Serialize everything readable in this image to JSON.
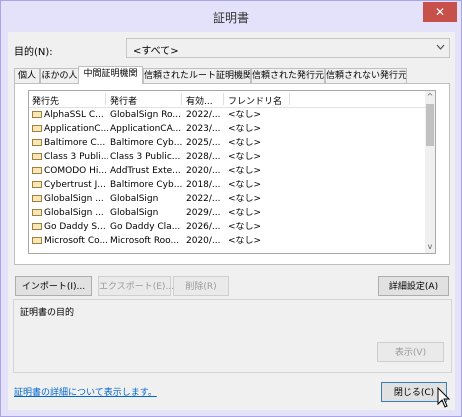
{
  "window": {
    "title": "証明書",
    "close_glyph": "✕"
  },
  "purpose": {
    "label": "目的(N):",
    "value": "<すべて>"
  },
  "tabs": [
    {
      "label": "個人"
    },
    {
      "label": "ほかの人"
    },
    {
      "label": "中間証明機関"
    },
    {
      "label": "信頼されたルート証明機関"
    },
    {
      "label": "信頼された発行元"
    },
    {
      "label": "信頼されない発行元"
    }
  ],
  "columns": [
    "発行先",
    "発行者",
    "有効...",
    "フレンドリ名"
  ],
  "rows": [
    {
      "issued_to": "AlphaSSL C...",
      "issued_by": "GlobalSign Ro...",
      "expires": "2022/...",
      "friendly": "<なし>"
    },
    {
      "issued_to": "ApplicationC...",
      "issued_by": "ApplicationCA...",
      "expires": "2023/...",
      "friendly": "<なし>"
    },
    {
      "issued_to": "Baltimore C...",
      "issued_by": "Baltimore Cyb...",
      "expires": "2025/...",
      "friendly": "<なし>"
    },
    {
      "issued_to": "Class 3 Publi...",
      "issued_by": "Class 3 Public...",
      "expires": "2028/...",
      "friendly": "<なし>"
    },
    {
      "issued_to": "COMODO Hi...",
      "issued_by": "AddTrust Exte...",
      "expires": "2020/...",
      "friendly": "<なし>"
    },
    {
      "issued_to": "Cybertrust J...",
      "issued_by": "Baltimore Cyb...",
      "expires": "2018/...",
      "friendly": "<なし>"
    },
    {
      "issued_to": "GlobalSign ...",
      "issued_by": "GlobalSign",
      "expires": "2022/...",
      "friendly": "<なし>"
    },
    {
      "issued_to": "GlobalSign ...",
      "issued_by": "GlobalSign",
      "expires": "2029/...",
      "friendly": "<なし>"
    },
    {
      "issued_to": "Go Daddy S...",
      "issued_by": "Go Daddy Cla...",
      "expires": "2026/...",
      "friendly": "<なし>"
    },
    {
      "issued_to": "Microsoft Co...",
      "issued_by": "Microsoft Roo...",
      "expires": "2020/...",
      "friendly": "<なし>"
    }
  ],
  "buttons": {
    "import": "インポート(I)...",
    "export": "エクスポート(E)...",
    "remove": "削除(R)",
    "advanced": "詳細設定(A)",
    "view": "表示(V)",
    "close": "閉じる(C)"
  },
  "purpose_group": {
    "label": "証明書の目的"
  },
  "link": {
    "text": "証明書の詳細について表示します。"
  },
  "scroll": {
    "up": "^",
    "down": "v"
  },
  "colors": {
    "close_button": "#c7504a",
    "link": "#0066cc",
    "titlebar": "#e4e2fb"
  },
  "icons": {
    "certificate": "certificate-icon",
    "cursor": "mouse-cursor-icon"
  }
}
